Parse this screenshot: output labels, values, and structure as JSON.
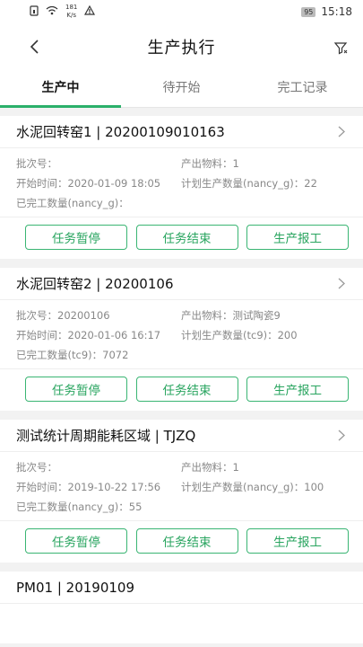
{
  "status_bar": {
    "speed_value": "181",
    "speed_unit": "K/s",
    "battery": "95",
    "time": "15:18"
  },
  "header": {
    "title": "生产执行"
  },
  "tabs": [
    {
      "label": "生产中",
      "active": true
    },
    {
      "label": "待开始",
      "active": false
    },
    {
      "label": "完工记录",
      "active": false
    }
  ],
  "cards": [
    {
      "title": "水泥回转窑1 | 20200109010163",
      "batch": "批次号：",
      "material": "产出物料：1",
      "start": "开始时间：2020-01-09 18:05",
      "planned": "计划生产数量(nancy_g)：22",
      "completed": "已完工数量(nancy_g)：",
      "actions": [
        "任务暂停",
        "任务结束",
        "生产报工"
      ]
    },
    {
      "title": "水泥回转窑2 | 20200106",
      "batch": "批次号：20200106",
      "material": "产出物料：测试陶瓷9",
      "start": "开始时间：2020-01-06 16:17",
      "planned": "计划生产数量(tc9)：200",
      "completed": "已完工数量(tc9)：7072",
      "actions": [
        "任务暂停",
        "任务结束",
        "生产报工"
      ]
    },
    {
      "title": "测试统计周期能耗区域 | TJZQ",
      "batch": "批次号：",
      "material": "产出物料：1",
      "start": "开始时间：2019-10-22 17:56",
      "planned": "计划生产数量(nancy_g)：100",
      "completed": "已完工数量(nancy_g)：55",
      "actions": [
        "任务暂停",
        "任务结束",
        "生产报工"
      ]
    }
  ],
  "partial_card": {
    "title": "PM01 | 20190109"
  },
  "colors": {
    "accent": "#2bb06a",
    "button_border": "#3ab573"
  }
}
